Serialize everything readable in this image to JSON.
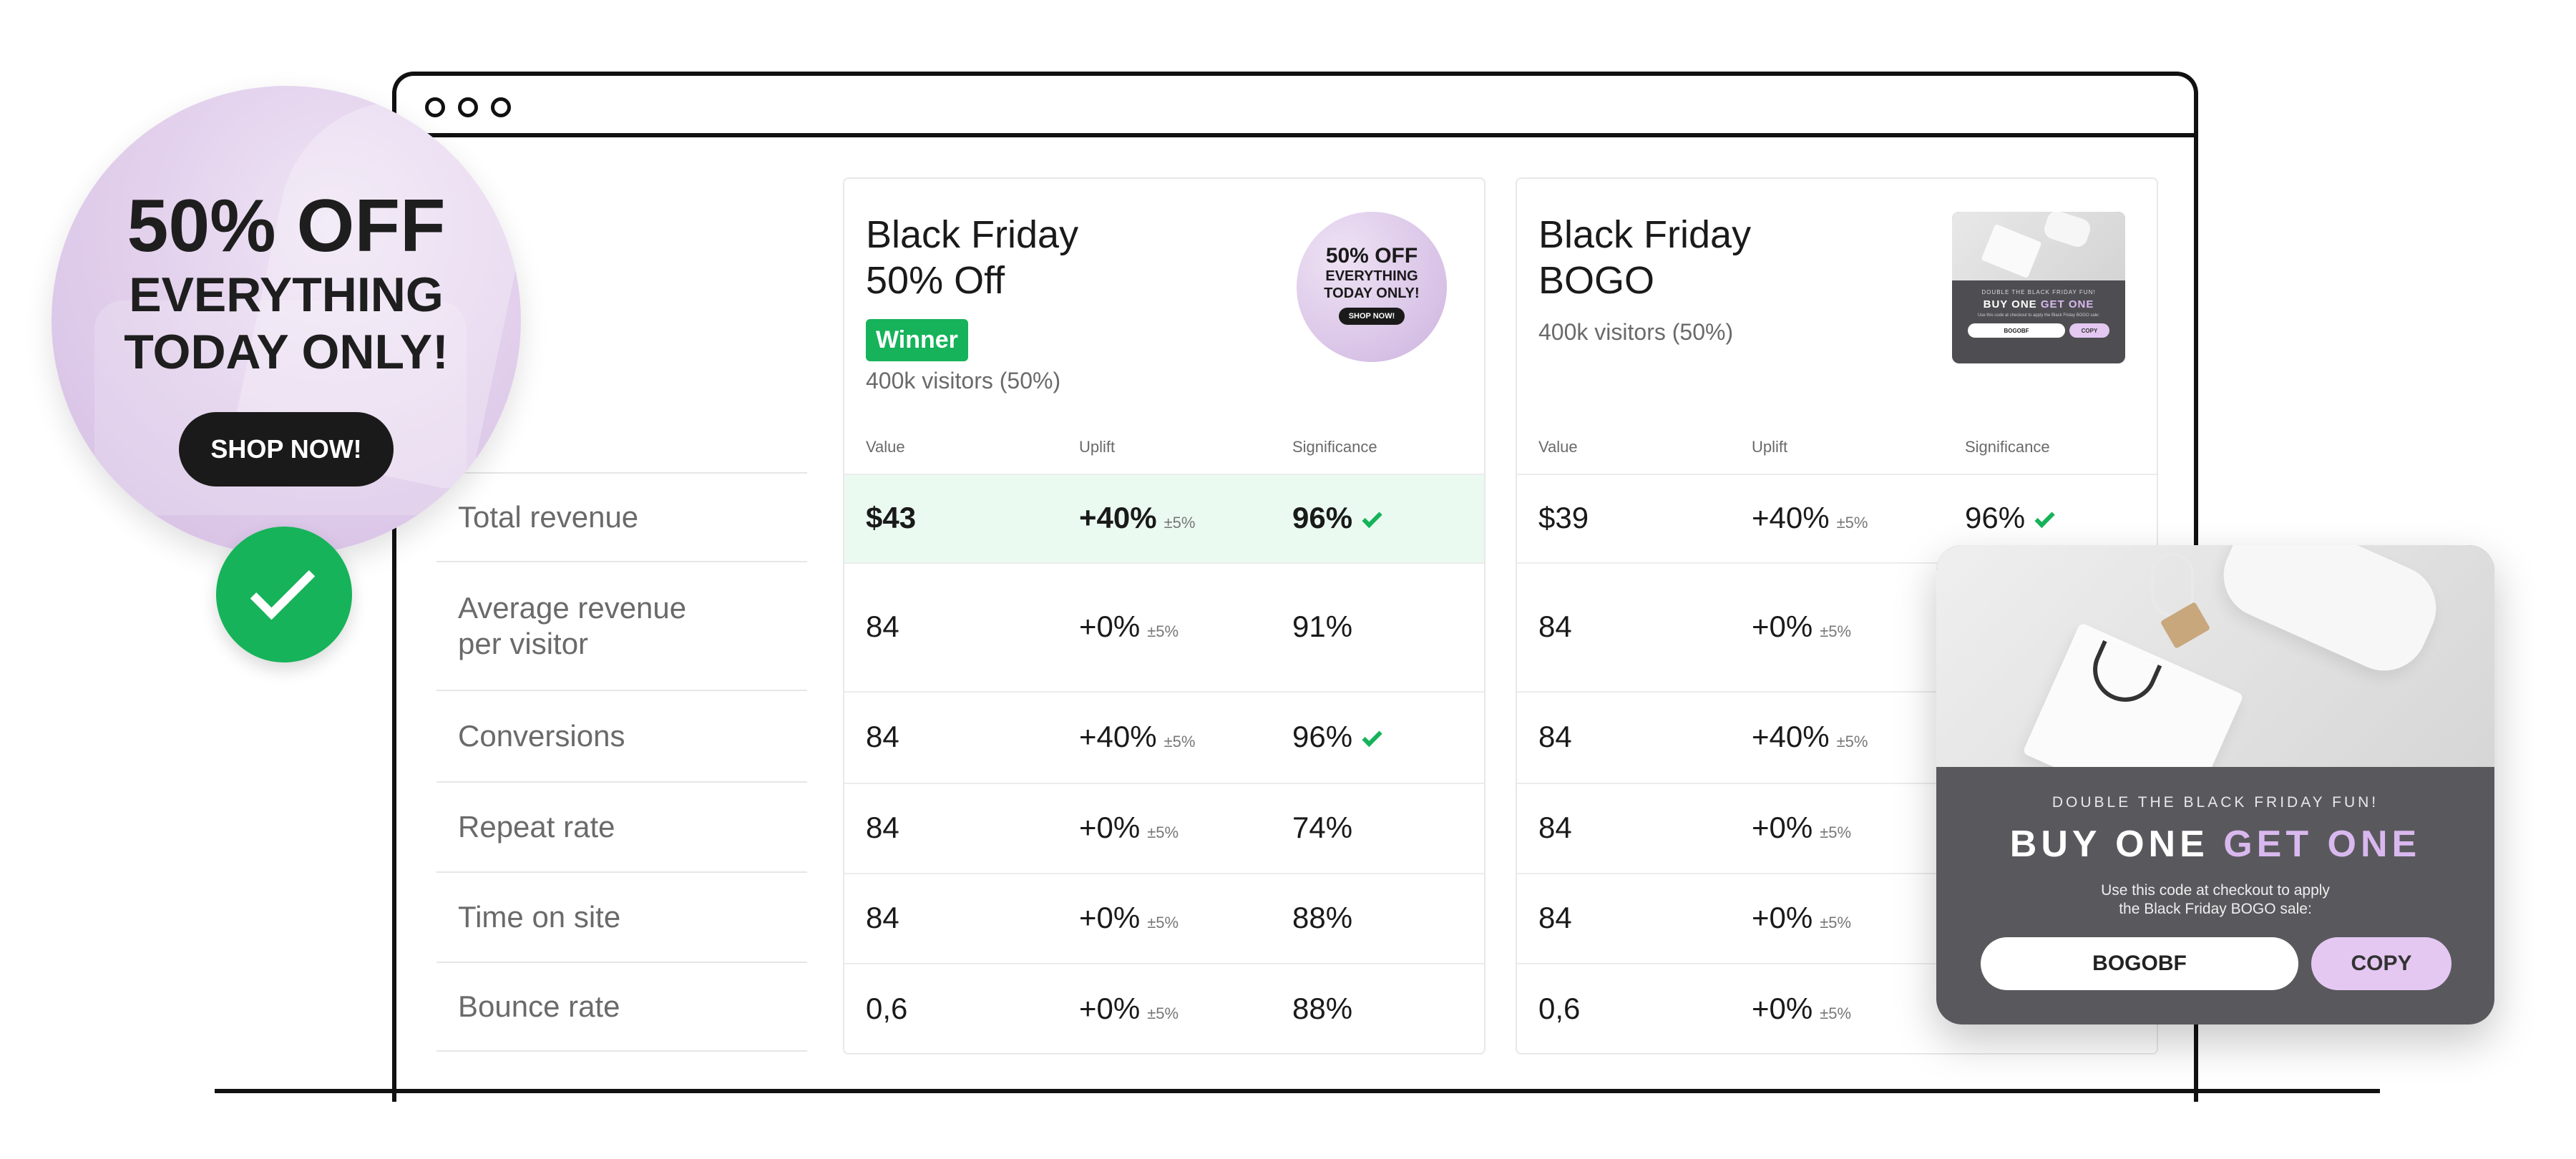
{
  "promo": {
    "headline": "50% OFF",
    "line2": "EVERYTHING",
    "line3": "TODAY ONLY!",
    "button": "SHOP NOW!"
  },
  "row_labels": [
    "Total revenue",
    "Average revenue\nper visitor",
    "Conversions",
    "Repeat rate",
    "Time on site",
    "Bounce rate"
  ],
  "columns": {
    "value": "Value",
    "uplift": "Uplift",
    "significance": "Significance"
  },
  "variant_a": {
    "title_line1": "Black Friday",
    "title_line2": "50% Off",
    "badge": "Winner",
    "visitors": "400k visitors (50%)",
    "thumb": {
      "line1": "50% OFF",
      "line2": "EVERYTHING",
      "line3": "TODAY ONLY!",
      "button": "SHOP NOW!"
    },
    "rows": [
      {
        "value": "$43",
        "uplift": "+40%",
        "pm": "±5%",
        "sig": "96%",
        "check": true
      },
      {
        "value": "84",
        "uplift": "+0%",
        "pm": "±5%",
        "sig": "91%",
        "check": false
      },
      {
        "value": "84",
        "uplift": "+40%",
        "pm": "±5%",
        "sig": "96%",
        "check": true
      },
      {
        "value": "84",
        "uplift": "+0%",
        "pm": "±5%",
        "sig": "74%",
        "check": false
      },
      {
        "value": "84",
        "uplift": "+0%",
        "pm": "±5%",
        "sig": "88%",
        "check": false
      },
      {
        "value": "0,6",
        "uplift": "+0%",
        "pm": "±5%",
        "sig": "88%",
        "check": false
      }
    ]
  },
  "variant_b": {
    "title_line1": "Black Friday",
    "title_line2": "BOGO",
    "visitors": "400k visitors (50%)",
    "thumb": {
      "sub": "DOUBLE THE BLACK FRIDAY FUN!",
      "head_a": "BUY ONE",
      "head_b": "GET ONE",
      "desc": "Use this code at checkout to apply the Black Friday BOGO sale:",
      "code": "BOGOBF",
      "copy": "COPY"
    },
    "rows": [
      {
        "value": "$39",
        "uplift": "+40%",
        "pm": "±5%",
        "sig": "96%",
        "check": true
      },
      {
        "value": "84",
        "uplift": "+0%",
        "pm": "±5%",
        "sig": "",
        "check": false
      },
      {
        "value": "84",
        "uplift": "+40%",
        "pm": "±5%",
        "sig": "",
        "check": false
      },
      {
        "value": "84",
        "uplift": "+0%",
        "pm": "±5%",
        "sig": "",
        "check": false
      },
      {
        "value": "84",
        "uplift": "+0%",
        "pm": "±5%",
        "sig": "",
        "check": false
      },
      {
        "value": "0,6",
        "uplift": "+0%",
        "pm": "±5%",
        "sig": "",
        "check": false
      }
    ]
  },
  "popup": {
    "sub": "DOUBLE THE BLACK FRIDAY FUN!",
    "head_a": "BUY ONE",
    "head_b": "GET ONE",
    "desc_line1": "Use this code at checkout to apply",
    "desc_line2": "the Black Friday BOGO sale:",
    "code": "BOGOBF",
    "copy": "COPY"
  }
}
